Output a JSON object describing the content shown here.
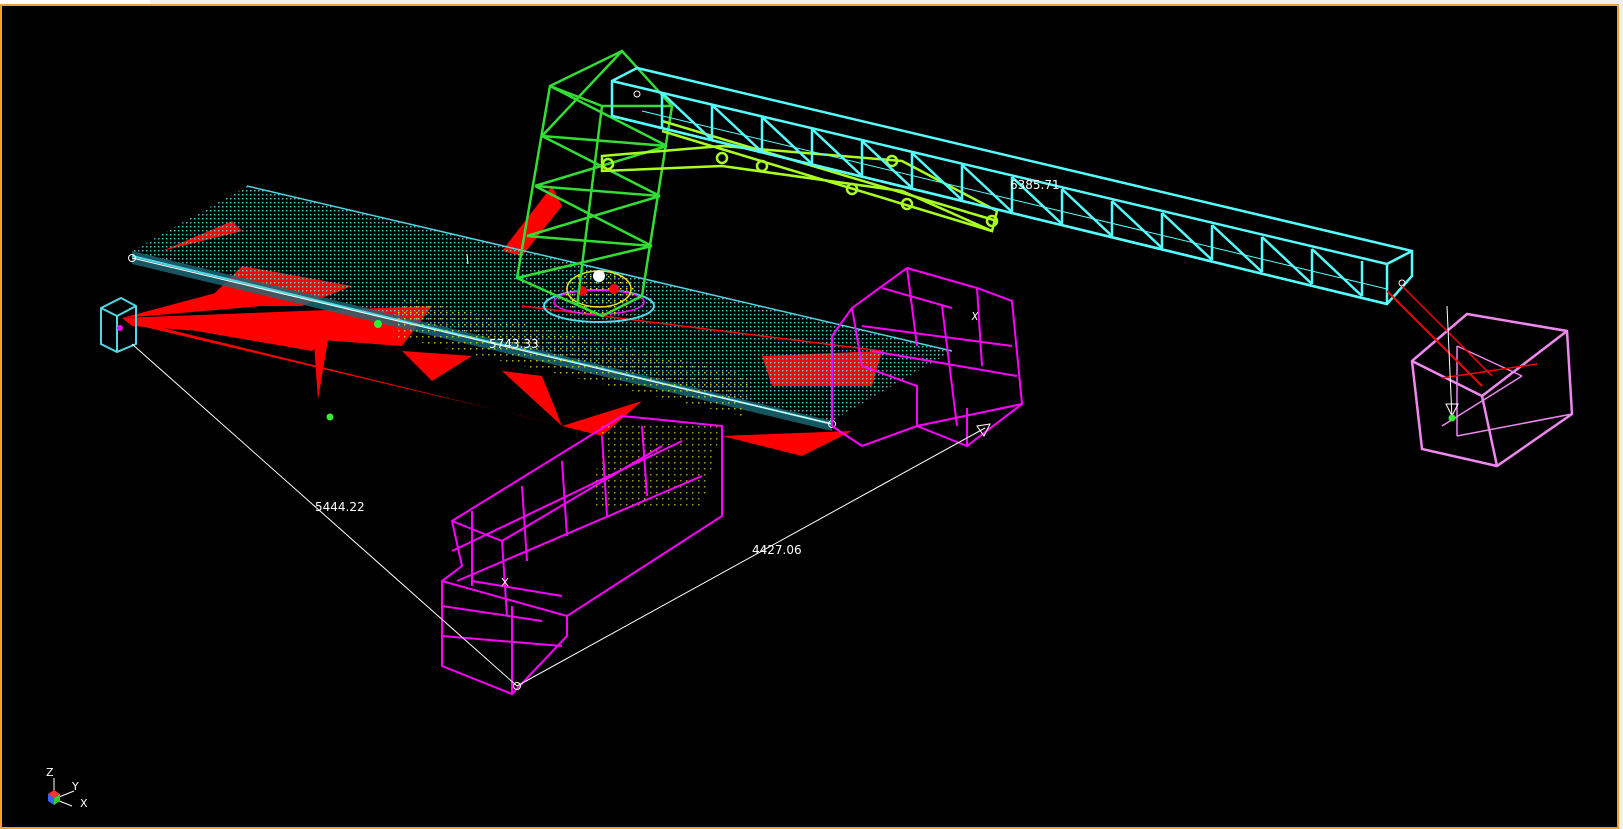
{
  "viewport": {
    "background": "#000000",
    "border_color": "#f0a030"
  },
  "measurements": {
    "beam_length": "5743.33",
    "boom_length": "6385.71",
    "diagonal_left": "5444.22",
    "diagonal_right": "4427.06"
  },
  "triad": {
    "z_label": "Z",
    "y_label": "Y",
    "x_label": "X"
  },
  "colors": {
    "beam": "#4fd7e6",
    "boom": "#55ffff",
    "tower": "#33dd33",
    "cabin": "#aaff22",
    "outrigger": "#ff00ff",
    "counterweight": "#ee88ee",
    "contact": "#ff0000",
    "dimension": "#ffffff",
    "node": "#ffd800"
  }
}
